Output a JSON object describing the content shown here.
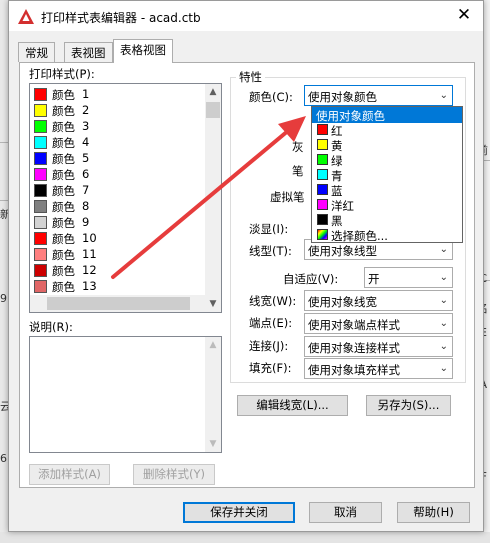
{
  "window": {
    "title": "打印样式表编辑器 - acad.ctb",
    "close_glyph": "✕",
    "accent": "#d32f2f"
  },
  "tabs": [
    {
      "label": "常规",
      "active": false
    },
    {
      "label": "表视图",
      "active": false
    },
    {
      "label": "表格视图",
      "active": true
    }
  ],
  "styles_panel": {
    "label": "打印样式(P):",
    "items": [
      {
        "name": "颜色",
        "num": "1",
        "color": "#ff0000"
      },
      {
        "name": "颜色",
        "num": "2",
        "color": "#ffff00"
      },
      {
        "name": "颜色",
        "num": "3",
        "color": "#00ff00"
      },
      {
        "name": "颜色",
        "num": "4",
        "color": "#00ffff"
      },
      {
        "name": "颜色",
        "num": "5",
        "color": "#0000ff"
      },
      {
        "name": "颜色",
        "num": "6",
        "color": "#ff00ff"
      },
      {
        "name": "颜色",
        "num": "7",
        "color": "#000000"
      },
      {
        "name": "颜色",
        "num": "8",
        "color": "#808080"
      },
      {
        "name": "颜色",
        "num": "9",
        "color": "#d3d3d3"
      },
      {
        "name": "颜色",
        "num": "10",
        "color": "#ff0000"
      },
      {
        "name": "颜色",
        "num": "11",
        "color": "#ff7f7f"
      },
      {
        "name": "颜色",
        "num": "12",
        "color": "#cc0000"
      },
      {
        "name": "颜色",
        "num": "13",
        "color": "#e06666"
      }
    ]
  },
  "description": {
    "label": "说明(R):"
  },
  "left_buttons": {
    "add": "添加样式(A)",
    "delete": "删除样式(Y)"
  },
  "properties": {
    "group_title": "特性",
    "color": {
      "label": "颜色(C):",
      "value": "使用对象颜色"
    },
    "dropdown_items": [
      {
        "text": "使用对象颜色",
        "color": "",
        "selected": true
      },
      {
        "text": "红",
        "color": "#ff0000"
      },
      {
        "text": "黄",
        "color": "#ffff00"
      },
      {
        "text": "绿",
        "color": "#00ff00"
      },
      {
        "text": "青",
        "color": "#00ffff"
      },
      {
        "text": "蓝",
        "color": "#0000ff"
      },
      {
        "text": "洋红",
        "color": "#ff00ff"
      },
      {
        "text": "黑",
        "color": "#000000"
      },
      {
        "text": "选择颜色...",
        "color": "rainbow"
      }
    ],
    "hidden_fragments": {
      "gray": "灰",
      "pen": "笔",
      "virtual_pen": "虚拟笔"
    },
    "screening": {
      "label": "淡显(I):"
    },
    "linetype": {
      "label": "线型(T):",
      "value": "使用对象线型"
    },
    "adaptive": {
      "label": "自适应(V):",
      "value": "开"
    },
    "lineweight": {
      "label": "线宽(W):",
      "value": "使用对象线宽"
    },
    "endpoint": {
      "label": "端点(E):",
      "value": "使用对象端点样式"
    },
    "join": {
      "label": "连接(J):",
      "value": "使用对象连接样式"
    },
    "fill": {
      "label": "填充(F):",
      "value": "使用对象填充样式"
    }
  },
  "right_buttons": {
    "edit_lineweight": "编辑线宽(L)...",
    "save_as": "另存为(S)..."
  },
  "bottom_buttons": {
    "save_close": "保存并关闭",
    "cancel": "取消",
    "help": "帮助(H)"
  },
  "background_fragments": {
    "left_a": "新",
    "left_b": "9",
    "left_c": "云",
    "left_d": "6",
    "right_a": "前",
    "right_b": "C",
    "right_c": "名",
    "right_d": "E",
    "right_e": "A",
    "right_f": "F"
  }
}
